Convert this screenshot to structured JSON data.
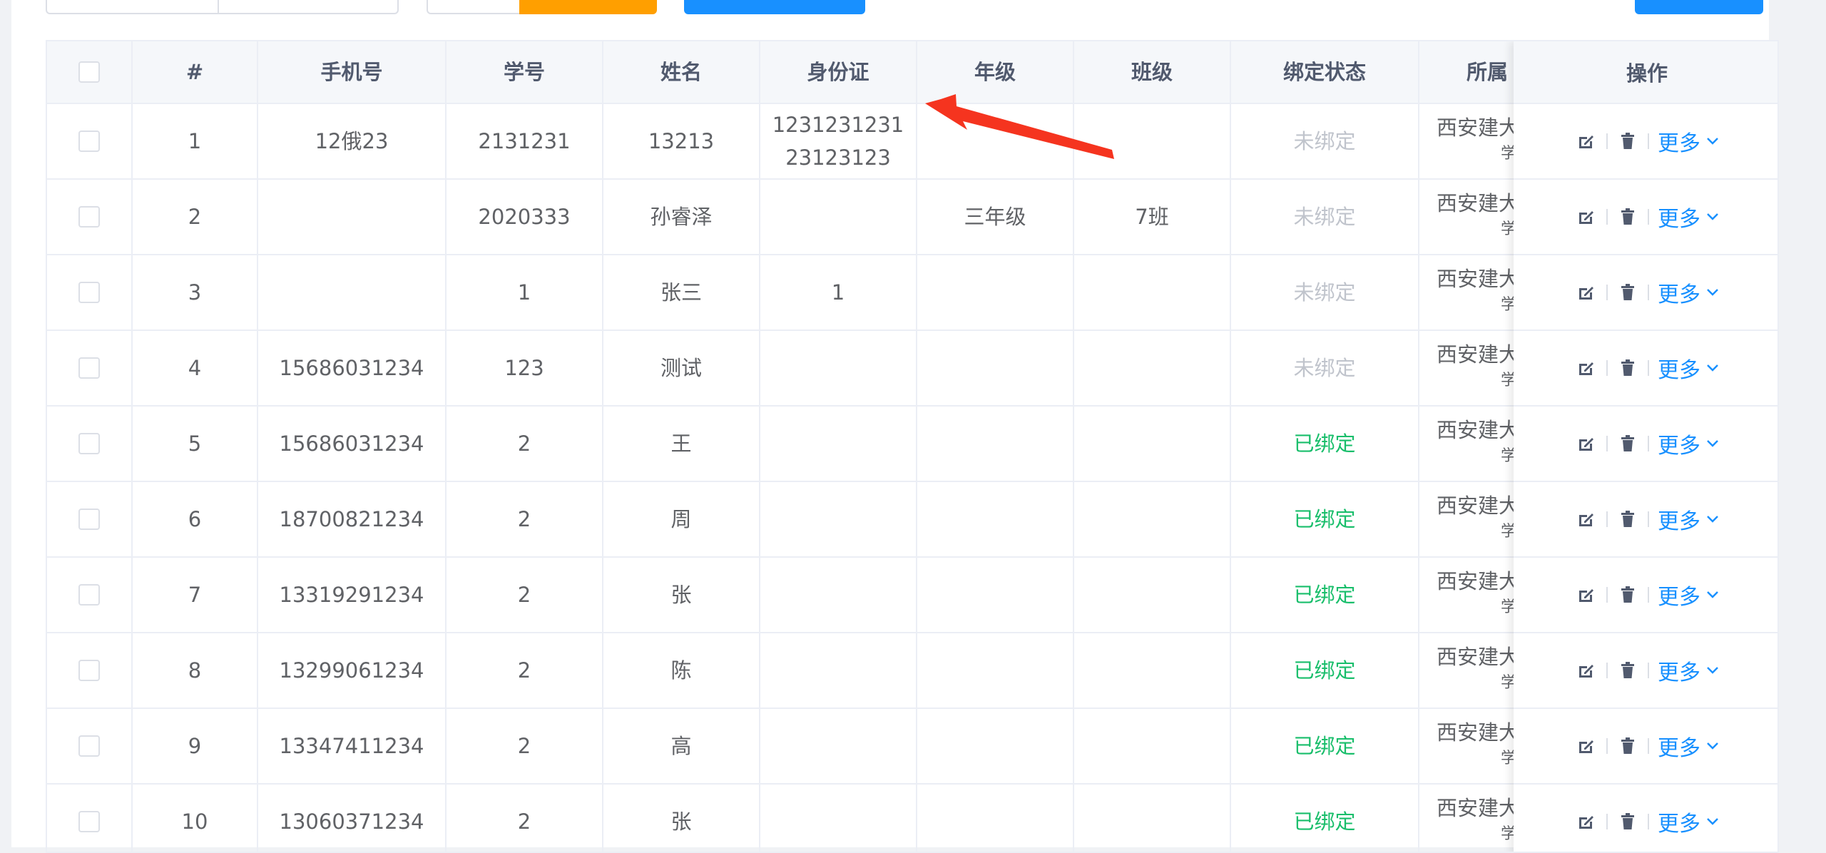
{
  "table": {
    "headers": {
      "index": "#",
      "phone": "手机号",
      "student_no": "学号",
      "name": "姓名",
      "id_card": "身份证",
      "grade": "年级",
      "class": "班级",
      "bind_status": "绑定状态",
      "org": "所属",
      "ops": "操作"
    },
    "rows": [
      {
        "index": "1",
        "phone": "12俄23",
        "student_no": "2131231",
        "name": "13213",
        "id_card_line1": "1231231231",
        "id_card_line2": "23123123",
        "grade": "",
        "class": "",
        "status": "未绑定",
        "org": "西安建大",
        "org2": "学"
      },
      {
        "index": "2",
        "phone": "",
        "student_no": "2020333",
        "name": "孙睿泽",
        "id_card_line1": "",
        "id_card_line2": "",
        "grade": "三年级",
        "class": "7班",
        "status": "未绑定",
        "org": "西安建大",
        "org2": "学"
      },
      {
        "index": "3",
        "phone": "",
        "student_no": "1",
        "name": "张三",
        "id_card_line1": "1",
        "id_card_line2": "",
        "grade": "",
        "class": "",
        "status": "未绑定",
        "org": "西安建大",
        "org2": "学"
      },
      {
        "index": "4",
        "phone": "15686031234",
        "student_no": "123",
        "name": "测试",
        "id_card_line1": "",
        "id_card_line2": "",
        "grade": "",
        "class": "",
        "status": "未绑定",
        "org": "西安建大",
        "org2": "学"
      },
      {
        "index": "5",
        "phone": "15686031234",
        "student_no": "2",
        "name": "王",
        "id_card_line1": "",
        "id_card_line2": "",
        "grade": "",
        "class": "",
        "status": "已绑定",
        "org": "西安建大",
        "org2": "学"
      },
      {
        "index": "6",
        "phone": "18700821234",
        "student_no": "2",
        "name": "周",
        "id_card_line1": "",
        "id_card_line2": "",
        "grade": "",
        "class": "",
        "status": "已绑定",
        "org": "西安建大",
        "org2": "学"
      },
      {
        "index": "7",
        "phone": "13319291234",
        "student_no": "2",
        "name": "张",
        "id_card_line1": "",
        "id_card_line2": "",
        "grade": "",
        "class": "",
        "status": "已绑定",
        "org": "西安建大",
        "org2": "学"
      },
      {
        "index": "8",
        "phone": "13299061234",
        "student_no": "2",
        "name": "陈",
        "id_card_line1": "",
        "id_card_line2": "",
        "grade": "",
        "class": "",
        "status": "已绑定",
        "org": "西安建大",
        "org2": "学"
      },
      {
        "index": "9",
        "phone": "13347411234",
        "student_no": "2",
        "name": "高",
        "id_card_line1": "",
        "id_card_line2": "",
        "grade": "",
        "class": "",
        "status": "已绑定",
        "org": "西安建大",
        "org2": "学"
      },
      {
        "index": "10",
        "phone": "13060371234",
        "student_no": "2",
        "name": "张",
        "id_card_line1": "",
        "id_card_line2": "",
        "grade": "",
        "class": "",
        "status": "已绑定",
        "org": "西安建大",
        "org2": "学"
      }
    ],
    "more_label": "更多"
  },
  "colors": {
    "unbound": "#c0c4cc",
    "bound": "#19be6b",
    "link": "#1890ff",
    "annotation_arrow": "#f5341f",
    "orange_button": "#ff9f00",
    "blue_button": "#1890ff"
  },
  "icons": {
    "edit": "edit-icon",
    "delete": "trash-icon",
    "more": "chevron-down-icon"
  }
}
